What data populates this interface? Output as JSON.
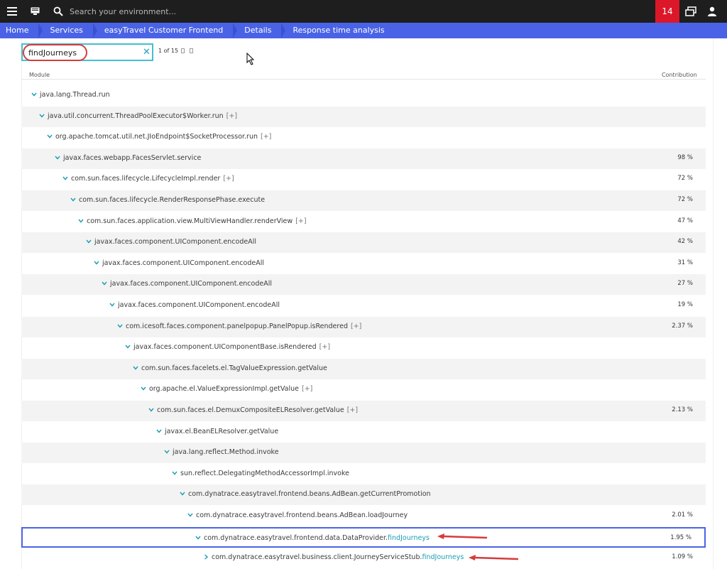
{
  "topbar": {
    "search_placeholder": "Search your environment...",
    "notification_count": "14"
  },
  "breadcrumb": [
    "Home",
    "Services",
    "easyTravel Customer Frontend",
    "Details",
    "Response time analysis"
  ],
  "search": {
    "value": "findJourneys",
    "result_count": "1 of 15"
  },
  "columns": {
    "module": "Module",
    "contribution": "Contribution"
  },
  "tree": [
    {
      "label": "java.lang.Thread.run",
      "highlight": "",
      "expand": "",
      "contribution": "",
      "depth": 0,
      "chevron": "down"
    },
    {
      "label": "java.util.concurrent.ThreadPoolExecutor$Worker.run",
      "highlight": "",
      "expand": "[+]",
      "contribution": "",
      "depth": 1,
      "chevron": "down"
    },
    {
      "label": "org.apache.tomcat.util.net.JIoEndpoint$SocketProcessor.run",
      "highlight": "",
      "expand": "[+]",
      "contribution": "",
      "depth": 2,
      "chevron": "down"
    },
    {
      "label": "javax.faces.webapp.FacesServlet.service",
      "highlight": "",
      "expand": "",
      "contribution": "98 %",
      "depth": 3,
      "chevron": "down"
    },
    {
      "label": "com.sun.faces.lifecycle.LifecycleImpl.render",
      "highlight": "",
      "expand": "[+]",
      "contribution": "72 %",
      "depth": 4,
      "chevron": "down"
    },
    {
      "label": "com.sun.faces.lifecycle.RenderResponsePhase.execute",
      "highlight": "",
      "expand": "",
      "contribution": "72 %",
      "depth": 5,
      "chevron": "down"
    },
    {
      "label": "com.sun.faces.application.view.MultiViewHandler.renderView",
      "highlight": "",
      "expand": "[+]",
      "contribution": "47 %",
      "depth": 6,
      "chevron": "down"
    },
    {
      "label": "javax.faces.component.UIComponent.encodeAll",
      "highlight": "",
      "expand": "",
      "contribution": "42 %",
      "depth": 7,
      "chevron": "down"
    },
    {
      "label": "javax.faces.component.UIComponent.encodeAll",
      "highlight": "",
      "expand": "",
      "contribution": "31 %",
      "depth": 8,
      "chevron": "down"
    },
    {
      "label": "javax.faces.component.UIComponent.encodeAll",
      "highlight": "",
      "expand": "",
      "contribution": "27 %",
      "depth": 9,
      "chevron": "down"
    },
    {
      "label": "javax.faces.component.UIComponent.encodeAll",
      "highlight": "",
      "expand": "",
      "contribution": "19 %",
      "depth": 10,
      "chevron": "down"
    },
    {
      "label": "com.icesoft.faces.component.panelpopup.PanelPopup.isRendered",
      "highlight": "",
      "expand": "[+]",
      "contribution": "2.37 %",
      "depth": 11,
      "chevron": "down"
    },
    {
      "label": "javax.faces.component.UIComponentBase.isRendered",
      "highlight": "",
      "expand": "[+]",
      "contribution": "",
      "depth": 12,
      "chevron": "down"
    },
    {
      "label": "com.sun.faces.facelets.el.TagValueExpression.getValue",
      "highlight": "",
      "expand": "",
      "contribution": "",
      "depth": 13,
      "chevron": "down"
    },
    {
      "label": "org.apache.el.ValueExpressionImpl.getValue",
      "highlight": "",
      "expand": "[+]",
      "contribution": "",
      "depth": 14,
      "chevron": "down"
    },
    {
      "label": "com.sun.faces.el.DemuxCompositeELResolver.getValue",
      "highlight": "",
      "expand": "[+]",
      "contribution": "2.13 %",
      "depth": 15,
      "chevron": "down"
    },
    {
      "label": "javax.el.BeanELResolver.getValue",
      "highlight": "",
      "expand": "",
      "contribution": "",
      "depth": 16,
      "chevron": "down"
    },
    {
      "label": "java.lang.reflect.Method.invoke",
      "highlight": "",
      "expand": "",
      "contribution": "",
      "depth": 17,
      "chevron": "down"
    },
    {
      "label": "sun.reflect.DelegatingMethodAccessorImpl.invoke",
      "highlight": "",
      "expand": "",
      "contribution": "",
      "depth": 18,
      "chevron": "down"
    },
    {
      "label": "com.dynatrace.easytravel.frontend.beans.AdBean.getCurrentPromotion",
      "highlight": "",
      "expand": "",
      "contribution": "",
      "depth": 19,
      "chevron": "down"
    },
    {
      "label": "com.dynatrace.easytravel.frontend.beans.AdBean.loadJourney",
      "highlight": "",
      "expand": "",
      "contribution": "2.01 %",
      "depth": 20,
      "chevron": "down"
    },
    {
      "label": "com.dynatrace.easytravel.frontend.data.DataProvider.",
      "highlight": "findJourneys",
      "expand": "",
      "contribution": "1.95 %",
      "depth": 21,
      "chevron": "down",
      "selected": true
    },
    {
      "label": "com.dynatrace.easytravel.business.client.JourneyServiceStub.",
      "highlight": "findJourneys",
      "expand": "",
      "contribution": "1.09 %",
      "depth": 22,
      "chevron": "right"
    }
  ],
  "colors": {
    "topbar": "#1e1e1e",
    "breadcrumb": "#4a63e6",
    "badge": "#dc172a",
    "accent": "#1a9db4",
    "selection": "#4a63e6",
    "annotation": "#d63b3b"
  }
}
